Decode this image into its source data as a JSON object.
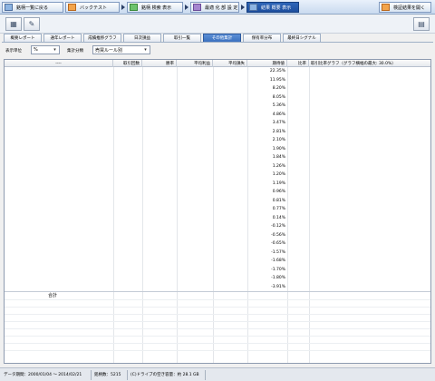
{
  "nav": {
    "items": [
      {
        "label": "銘柄一覧に戻る",
        "icon": "back-list-icon"
      },
      {
        "label": "バックテスト",
        "icon": "backtest-icon"
      },
      {
        "label": "銘柄 検索 表示",
        "icon": "search-results-icon"
      },
      {
        "label": "最適 化 部 設 定",
        "icon": "optimize-settings-icon"
      },
      {
        "label": "結果 概要 表示",
        "icon": "results-summary-icon"
      }
    ],
    "right_button": "検証結果を開く"
  },
  "tabs": [
    {
      "label": "概要レポート",
      "active": false
    },
    {
      "label": "通年レポート",
      "active": false
    },
    {
      "label": "成績推移グラフ",
      "active": false
    },
    {
      "label": "日次損益",
      "active": false
    },
    {
      "label": "取引一覧",
      "active": false
    },
    {
      "label": "その他集計",
      "active": true
    },
    {
      "label": "保有率分布",
      "active": false
    },
    {
      "label": "最終日シグナル",
      "active": false
    }
  ],
  "controls": {
    "unit_label": "表示単位",
    "unit_value": "%",
    "group_label": "集計分類",
    "group_value": "売買ルール別"
  },
  "table": {
    "headers": {
      "name": "----",
      "trades": "取引回数",
      "winrate": "勝率",
      "avg_profit": "平均利益",
      "avg_loss": "平均損失",
      "period_return": "期待値",
      "ratio": "比率",
      "graph": "取引比率グラフ（グラフ横幅の最大: 30.0%）"
    },
    "values": [
      "22.35%",
      "11.95%",
      "8.20%",
      "8.05%",
      "5.36%",
      "4.86%",
      "3.47%",
      "2.81%",
      "2.10%",
      "1.90%",
      "1.84%",
      "1.26%",
      "1.20%",
      "1.19%",
      "0.96%",
      "0.81%",
      "0.77%",
      "0.14%",
      "-0.12%",
      "-0.56%",
      "-0.65%",
      "-1.57%",
      "-1.68%",
      "-1.70%",
      "-1.80%",
      "-3.91%"
    ],
    "total_label": "合計"
  },
  "status": {
    "period": "データ期間：2000/01/04 ～ 2014/02/21",
    "count": "銘柄数：5215",
    "disk": "(C)ドライブの空き容量：約 28.1 GB"
  },
  "colors": {
    "active_tab": "#3b70bf",
    "toolbar": "#c9daef"
  }
}
